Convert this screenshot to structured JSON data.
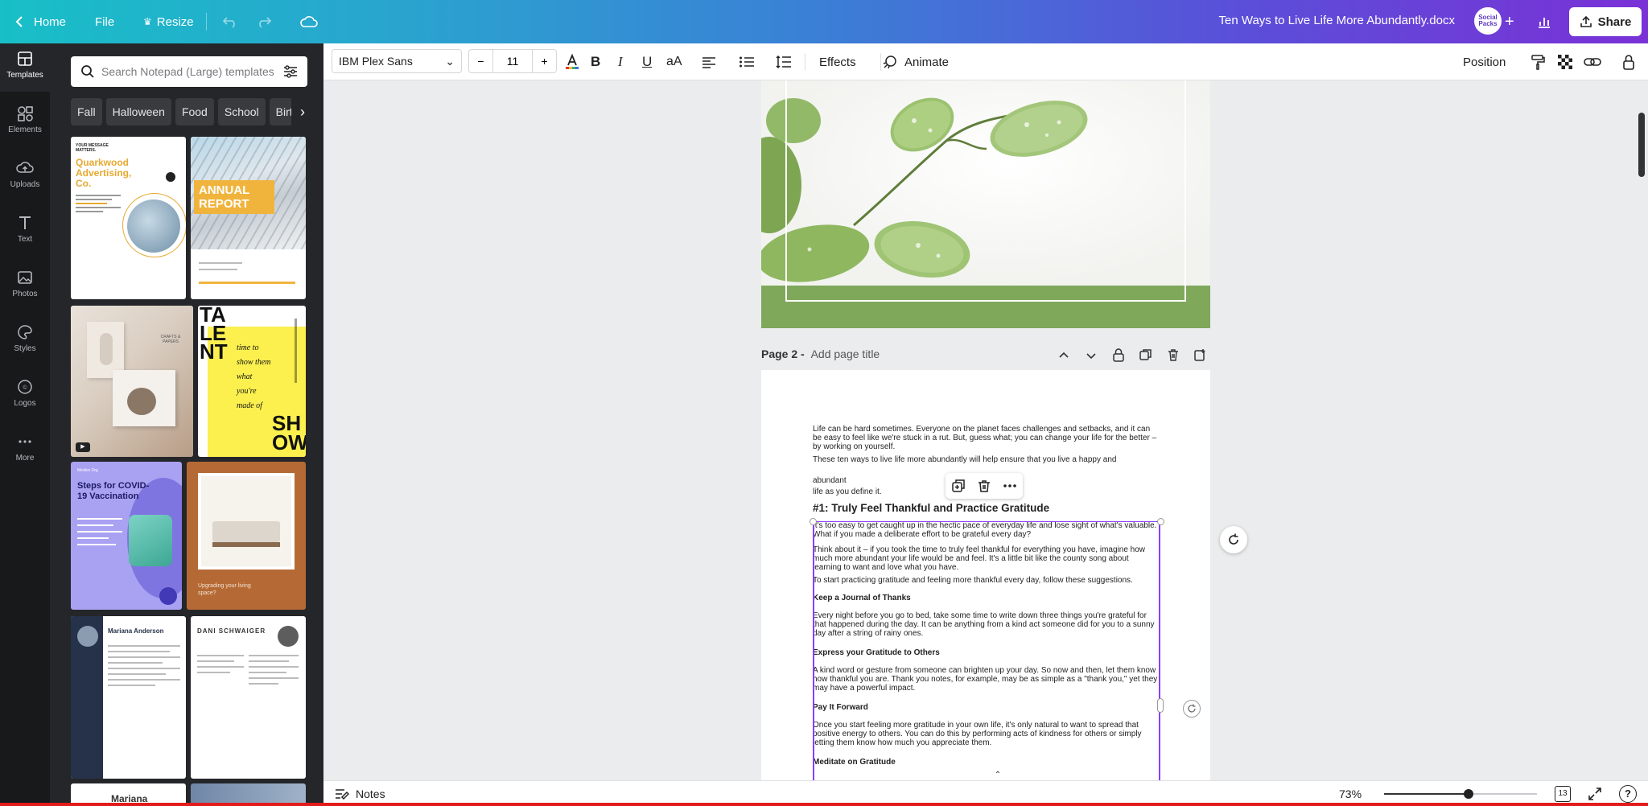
{
  "topbar": {
    "home": "Home",
    "file": "File",
    "resize": "Resize",
    "doc_title": "Ten Ways to Live Life More Abundantly.docx",
    "avatar_text": "Social Packs",
    "share": "Share"
  },
  "rail": {
    "items": [
      {
        "label": "Templates",
        "icon": "templates-icon"
      },
      {
        "label": "Elements",
        "icon": "elements-icon"
      },
      {
        "label": "Uploads",
        "icon": "uploads-icon"
      },
      {
        "label": "Text",
        "icon": "text-icon"
      },
      {
        "label": "Photos",
        "icon": "photos-icon"
      },
      {
        "label": "Styles",
        "icon": "styles-icon"
      },
      {
        "label": "Logos",
        "icon": "logos-icon"
      },
      {
        "label": "More",
        "icon": "more-icon"
      }
    ]
  },
  "panel": {
    "search_placeholder": "Search Notepad (Large) templates",
    "chips": [
      "Fall",
      "Halloween",
      "Food",
      "School",
      "Birt"
    ],
    "thumbs": {
      "t1_small": "YOUR MESSAGE MATTERS.",
      "t1_title": "Quarkwood Advertising, Co.",
      "t2_title": "ANNUAL REPORT",
      "t3_label": "CRAFTS & PAPERS",
      "t4_big": "TA LE NT",
      "t4_script": "time to show them what you're made of",
      "t4_bottom": "SH OW",
      "t5_org": "Medico Org",
      "t5_title": "Steps for COVID-19 Vaccination",
      "t6_caption": "Upgrading your living space?",
      "t7_name": "Mariana Anderson",
      "t8_name": "DANI SCHWAIGER",
      "t9_name": "Mariana"
    }
  },
  "toolbar": {
    "font": "IBM Plex Sans",
    "size_minus": "−",
    "size": "11",
    "size_plus": "+",
    "bold": "B",
    "italic": "I",
    "underline": "U",
    "case": "aA",
    "effects": "Effects",
    "animate": "Animate",
    "position": "Position"
  },
  "canvas": {
    "page2_label": "Page 2 -",
    "page2_title_placeholder": "Add page title",
    "doc": {
      "p1": "Life can be hard sometimes. Everyone on the planet faces challenges and setbacks, and it can be easy to feel like we're stuck in a rut. But, guess what; you can change your life for the better – by working on yourself.",
      "p2": "These ten ways to live life more abundantly will help ensure that you live a happy and",
      "p3a": "abundant",
      "p3b": "life as you define it.",
      "h1": "#1: Truly Feel Thankful and Practice Gratitude",
      "p4": "It's too easy to get caught up in the hectic pace of everyday life and lose sight of what's valuable. What if you made a deliberate effort to be grateful every day?",
      "p5": "Think about it – if you took the time to truly feel thankful for everything you have, imagine how much more abundant your life would be and feel. It's a little bit like the county song about learning to want and love what you have.",
      "p6": "To start practicing gratitude and feeling more thankful every day, follow these suggestions.",
      "s1": "Keep a Journal of Thanks",
      "p7": "Every night before you go to bed, take some time to write down three things you're grateful for that happened during the day. It can be anything from a kind act someone did for you to a sunny day after a string of rainy ones.",
      "s2": "Express your Gratitude to Others",
      "p8": "A kind word or gesture from someone can brighten up your day. So now and then, let them know how thankful you are. Thank you notes, for example, may be as simple as a \"thank you,\" yet they may have a powerful impact.",
      "s3": "Pay It Forward",
      "p9": "Once you start feeling more gratitude in your own life, it's only natural to want to spread that positive energy to others. You can do this by performing acts of kindness for others or simply letting them know how much you appreciate them.",
      "s4": "Meditate on Gratitude"
    }
  },
  "bottombar": {
    "notes": "Notes",
    "zoom": "73%",
    "zoom_fraction": 0.55,
    "page_count": "13"
  },
  "colors": {
    "accent": "#8b3dff",
    "page1_band": "#7fa85b",
    "rail_bg": "#18191b",
    "panel_bg": "#252629"
  }
}
